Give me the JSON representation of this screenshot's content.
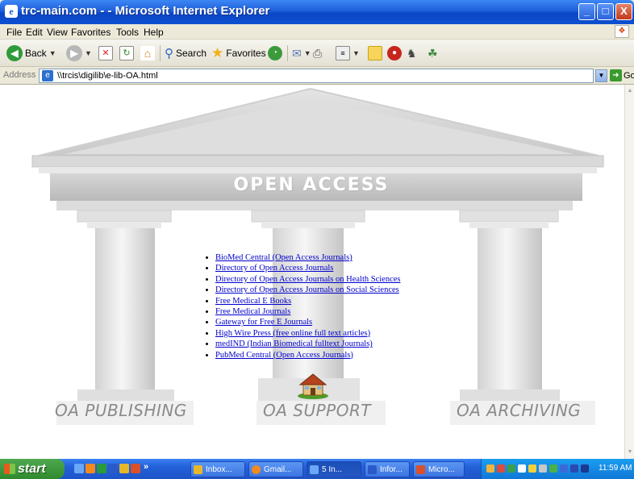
{
  "window": {
    "title": "trc-main.com - - Microsoft Internet Explorer",
    "controls": {
      "minimize": "_",
      "maximize": "□",
      "close": "X"
    }
  },
  "menu": [
    "File",
    "Edit",
    "View",
    "Favorites",
    "Tools",
    "Help"
  ],
  "toolbar": {
    "back": "Back",
    "search": "Search",
    "favorites": "Favorites"
  },
  "address": {
    "label": "Address",
    "value": "\\\\trcis\\digilib\\e-lib-OA.html",
    "go": "Go"
  },
  "page": {
    "banner": "OPEN ACCESS",
    "links": [
      "BioMed Central (Open Access Journals)",
      "Directory of Open Access Journals",
      "Directory of Open Access Journals on Health Sciences",
      "Directory of Open Access Journals on Social Sciences",
      "Free Medical E Books",
      "Free Medical Journals",
      "Gateway for Free E Journals",
      "High Wire Press (free online full text articles)",
      "medIND (Indian Biomedical fulltext Journals)",
      "PubMed Central (Open Access Journals)"
    ],
    "pillars": [
      "OA PUBLISHING",
      "OA SUPPORT",
      "OA ARCHIVING"
    ]
  },
  "taskbar": {
    "start": "start",
    "overflow": "»",
    "tasks": [
      "Inbox...",
      "Gmail...",
      "5 In...",
      "Infor...",
      "Micro..."
    ],
    "clock": "11:59 AM"
  }
}
